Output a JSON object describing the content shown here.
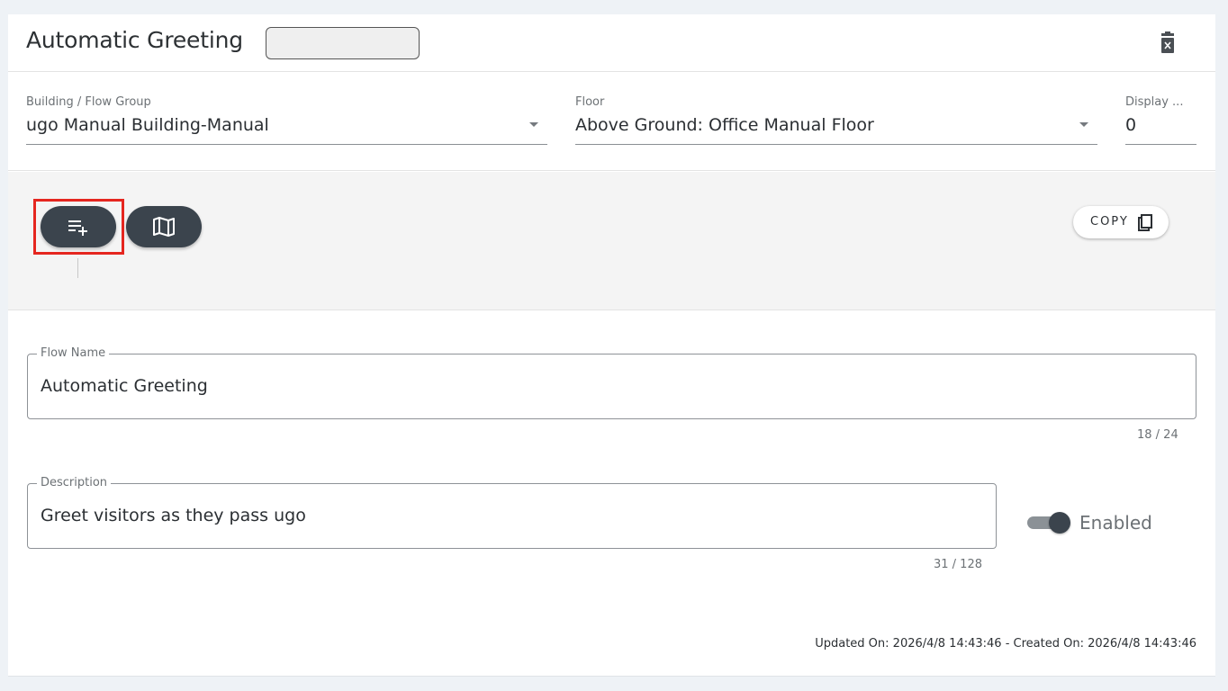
{
  "header": {
    "title": "Automatic Greeting",
    "delete_icon": "trash-icon"
  },
  "selects": {
    "building": {
      "label": "Building / Flow Group",
      "value": "ugo Manual Building-Manual"
    },
    "floor": {
      "label": "Floor",
      "value": "Above Ground: Office Manual Floor"
    },
    "display": {
      "label": "Display ...",
      "value": "0"
    }
  },
  "toolbar": {
    "add_list_icon": "playlist-add-icon",
    "map_icon": "map-icon",
    "copy_label": "COPY",
    "copy_icon": "clipboard-icon",
    "highlight_color": "#e5261f"
  },
  "form": {
    "flow_name": {
      "label": "Flow Name",
      "value": "Automatic Greeting",
      "counter": "18 / 24"
    },
    "description": {
      "label": "Description",
      "value": "Greet visitors as they pass ugo",
      "counter": "31 / 128"
    },
    "enabled": {
      "label": "Enabled",
      "on": true
    }
  },
  "footer": {
    "meta": "Updated On: 2026/4/8 14:43:46 - Created On: 2026/4/8 14:43:46"
  },
  "colors": {
    "background": "#eef2f6",
    "button": "#3b444d",
    "accent_red": "#e5261f"
  }
}
